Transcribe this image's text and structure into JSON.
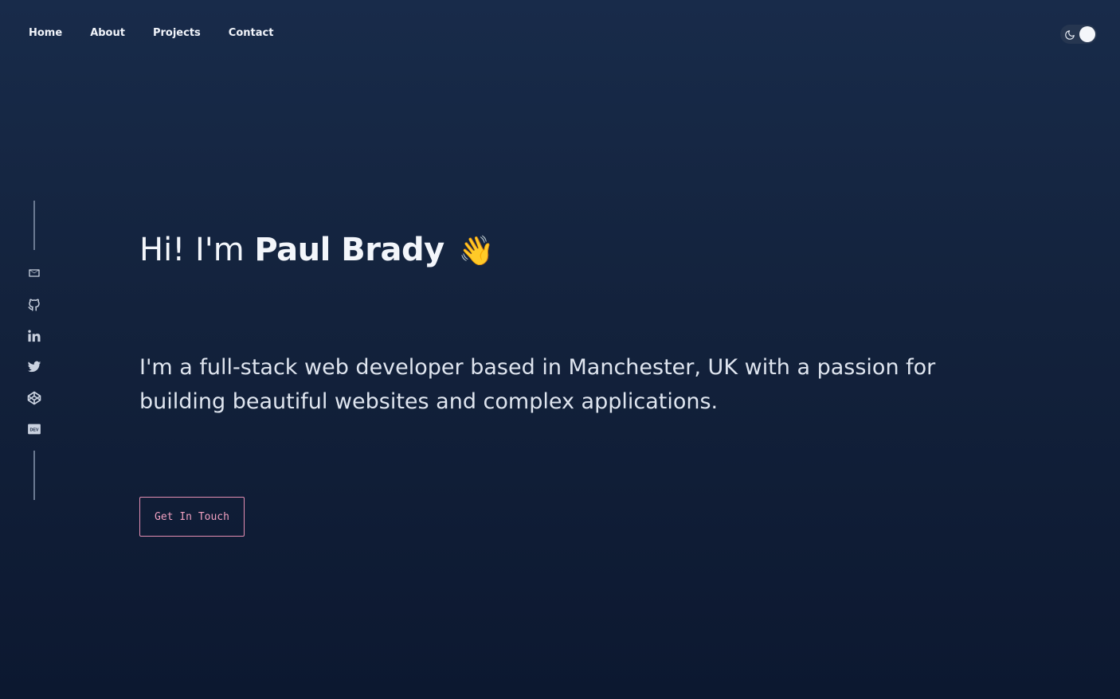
{
  "nav": {
    "items": [
      {
        "label": "Home"
      },
      {
        "label": "About"
      },
      {
        "label": "Projects"
      },
      {
        "label": "Contact"
      }
    ]
  },
  "theme_toggle": {
    "icon": "moon-icon"
  },
  "social": {
    "items": [
      {
        "icon": "email-icon"
      },
      {
        "icon": "github-icon"
      },
      {
        "icon": "linkedin-icon"
      },
      {
        "icon": "twitter-icon"
      },
      {
        "icon": "codepen-icon"
      },
      {
        "icon": "dev-icon",
        "badge": "DEV"
      }
    ]
  },
  "hero": {
    "greeting": "Hi! I'm",
    "name": "Paul Brady",
    "wave": "👋",
    "description": "I'm a full-stack web developer based in Manchester, UK with a passion for building beautiful websites and complex applications.",
    "cta_label": "Get In Touch"
  },
  "colors": {
    "background": "#13223c",
    "text": "#f3f6fb",
    "accent": "#e58fb3",
    "icon": "#c9d1df"
  }
}
